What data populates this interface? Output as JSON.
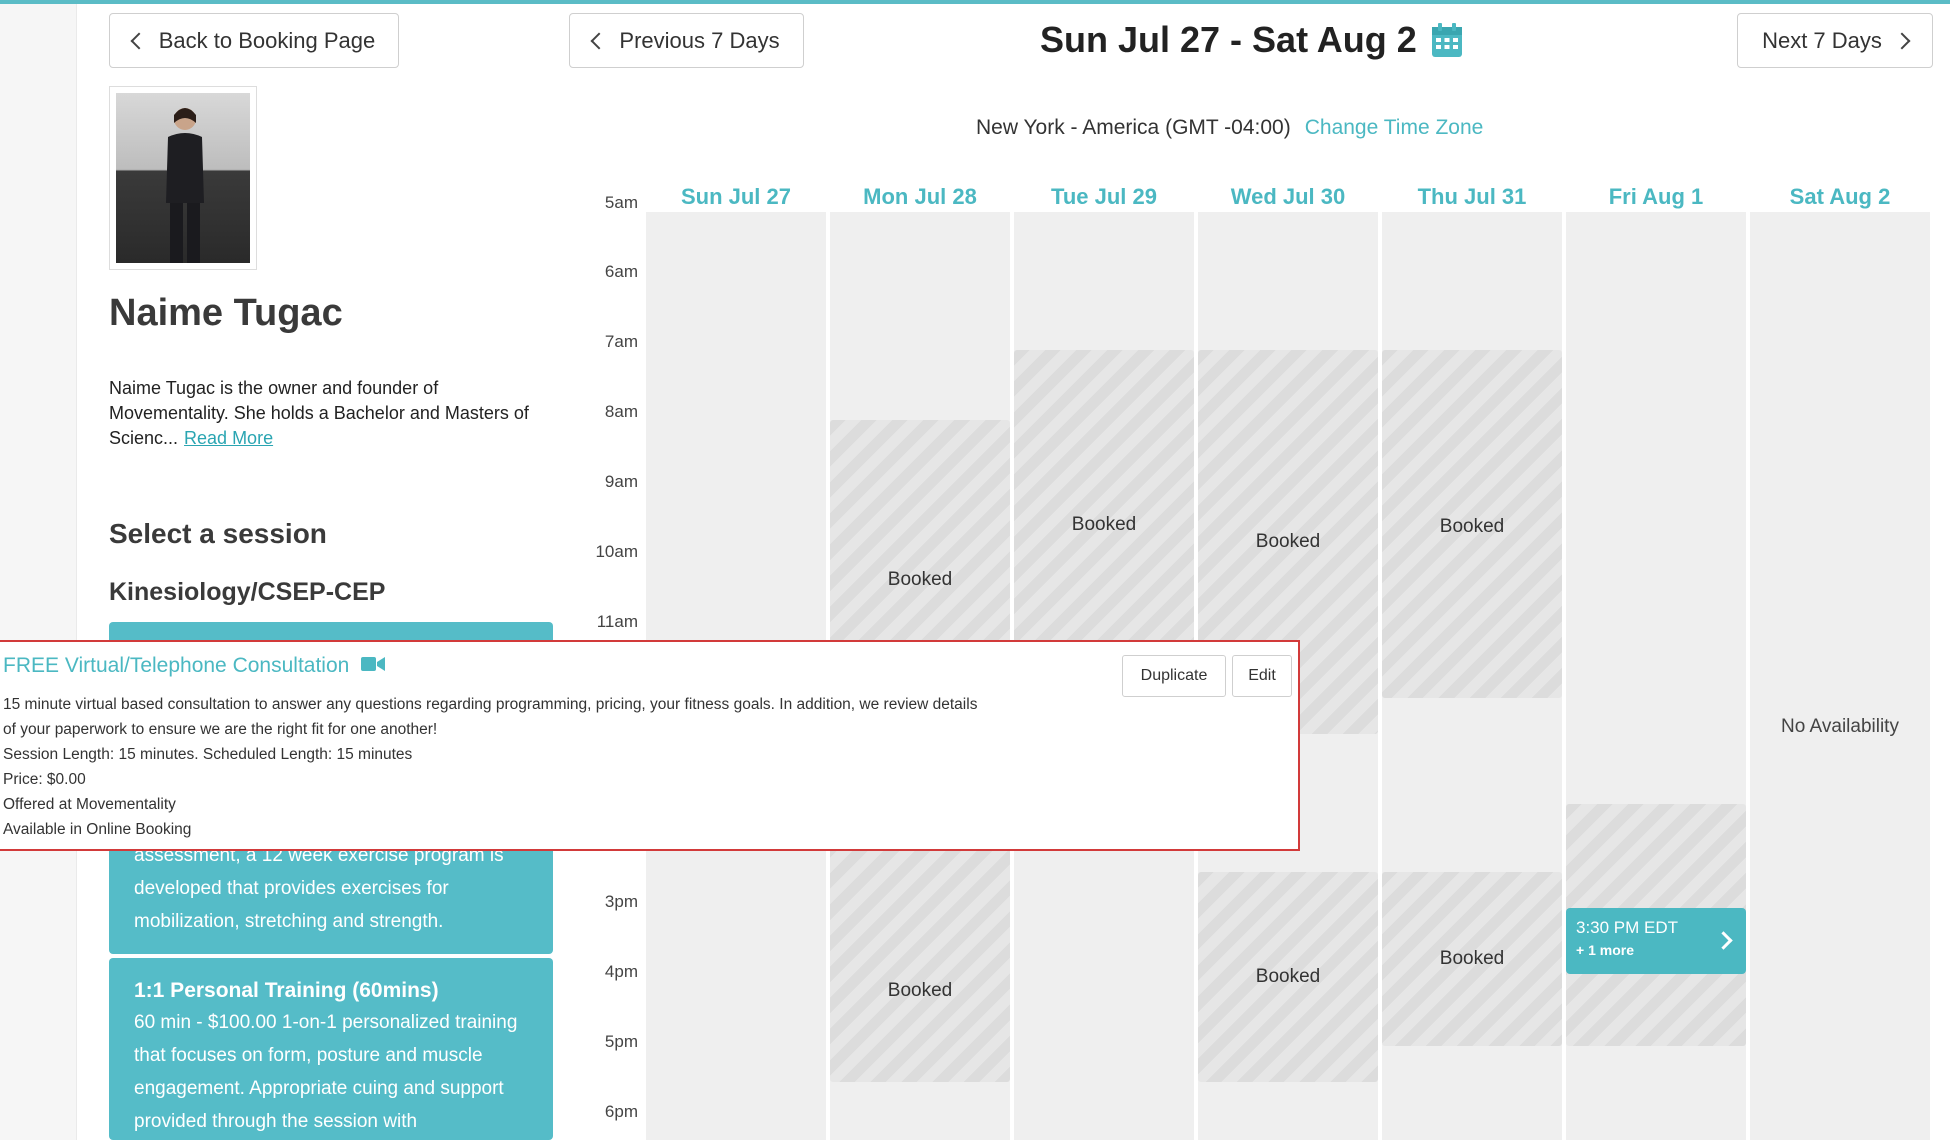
{
  "nav": {
    "back_label": "Back to Booking Page",
    "prev_label": "Previous 7 Days",
    "next_label": "Next 7 Days",
    "week_title": "Sun Jul 27 - Sat Aug 2"
  },
  "timezone": {
    "label": "New York - America (GMT -04:00)",
    "change_label": "Change Time Zone"
  },
  "profile": {
    "name": "Naime Tugac",
    "bio": "Naime Tugac is the owner and founder of Movementality. She holds a Bachelor and Masters of Scienc...",
    "read_more": "Read More"
  },
  "sessions": {
    "heading": "Select a session",
    "category": "Kinesiology/CSEP-CEP",
    "card1_lines": [
      "assessment, a 12 week exercise program is",
      "developed that provides exercises for",
      "mobilization, stretching and strength."
    ],
    "card2_title": "1:1 Personal Training (60mins)",
    "card2_lines": [
      "60 min - $100.00 1-on-1 personalized training",
      "that focuses on form, posture and muscle",
      "engagement. Appropriate cuing and support",
      "provided through the session with"
    ]
  },
  "hours": [
    "5am",
    "6am",
    "7am",
    "8am",
    "9am",
    "10am",
    "11am",
    "3pm",
    "4pm",
    "5pm",
    "6pm"
  ],
  "days": [
    "Sun Jul 27",
    "Mon Jul 28",
    "Tue Jul 29",
    "Wed Jul 30",
    "Thu Jul 31",
    "Fri Aug 1",
    "Sat Aug 2"
  ],
  "booked_label": "Booked",
  "no_availability": "No Availability",
  "slot": {
    "time": "3:30 PM EDT",
    "more": "+ 1 more"
  },
  "popup": {
    "title": "FREE Virtual/Telephone Consultation",
    "duplicate_label": "Duplicate",
    "edit_label": "Edit",
    "lines": [
      "15 minute virtual based consultation to answer any questions regarding programming, pricing, your fitness goals. In addition, we review details",
      "of your paperwork to ensure we are the right fit for one another!",
      "Session Length: 15 minutes. Scheduled Length: 15 minutes",
      "Price: $0.00",
      "Offered at Movementality",
      "Available in Online Booking"
    ]
  },
  "colors": {
    "accent": "#4bb8c2",
    "card": "#55bcc8",
    "popup_border": "#d23a3a"
  },
  "icons": {
    "calendar": "calendar-icon",
    "video": "video-camera-icon"
  }
}
